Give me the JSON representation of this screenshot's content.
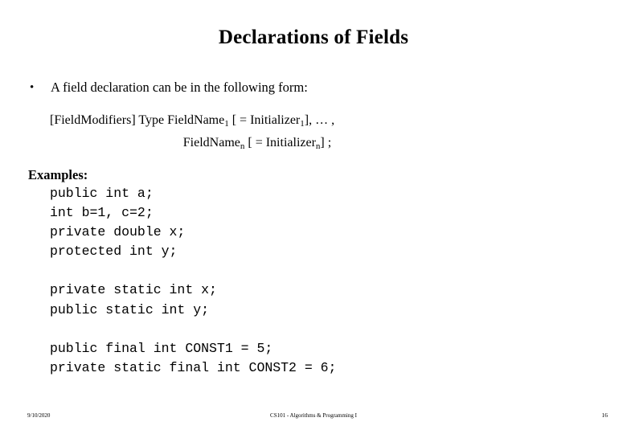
{
  "slide": {
    "title": "Declarations of Fields",
    "bullet": {
      "marker": "•",
      "text": "A field declaration can be in the following form:"
    },
    "syntax": {
      "line1_pre": "[FieldModifiers] Type FieldName",
      "line1_sub1": "1",
      "line1_mid": " [ = Initializer",
      "line1_sub2": "1",
      "line1_post": "],  … ,",
      "line2_pre": "FieldName",
      "line2_sub1": "n",
      "line2_mid": " [ = Initializer",
      "line2_sub2": "n",
      "line2_post": "] ;"
    },
    "examples_label": "Examples:",
    "code_lines": [
      "public int a;",
      "int b=1, c=2;",
      "private double x;",
      "protected int y;",
      "",
      "private static int x;",
      "public static int y;",
      "",
      "public final int CONST1 = 5;",
      "private static final int CONST2 = 6;"
    ],
    "footer": {
      "date": "9/10/2020",
      "center": "CS101 - Algorithms & Programming I",
      "page_number": "16"
    }
  },
  "colors": {
    "background": "#ffffff",
    "text": "#000000"
  }
}
